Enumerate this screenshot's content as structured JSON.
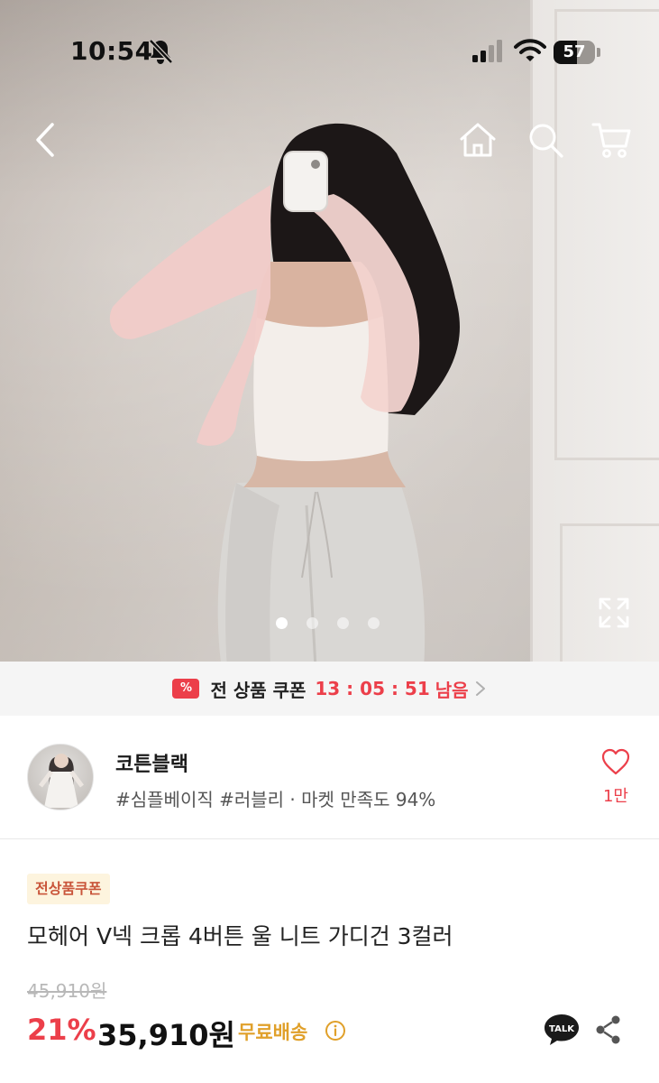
{
  "status_bar": {
    "time": "10:54",
    "battery": "57",
    "battery_level": 0.57
  },
  "nav": {
    "back_icon": "chevron-left-icon",
    "home_icon": "home-icon",
    "search_icon": "search-icon",
    "cart_icon": "cart-icon"
  },
  "gallery": {
    "dots_count": 4,
    "active_index": 0,
    "expand_icon": "expand-icon"
  },
  "coupon_bar": {
    "label": "전 상품 쿠폰",
    "timer": "13 : 05 : 51",
    "remain": "남음",
    "accent_color": "#ec3f4a"
  },
  "seller": {
    "name": "코튼블랙",
    "meta": "#심플베이직 #러블리 · 마켓 만족도 94%",
    "likes": "1만"
  },
  "product": {
    "badge": "전상품쿠폰",
    "title": "모헤어 V넥 크롭 4버튼 울 니트 가디건 3컬러",
    "original_price": "45,910원",
    "discount": "21%",
    "price": "35,910원",
    "shipping": "무료배송",
    "talk_label": "TALK"
  }
}
